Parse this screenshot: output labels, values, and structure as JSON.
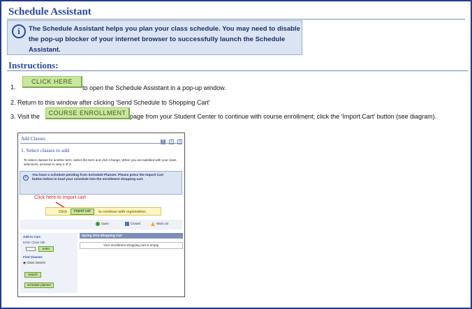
{
  "header": {
    "title": "Schedule Assistant",
    "info_icon": "info-icon",
    "info_text": "The Schedule Assistant helps you plan your class schedule.  You may need to disable the pop-up blocker of your internet browser to successfully launch the Schedule Assistant."
  },
  "instructions": {
    "title": "Instructions:",
    "step1": {
      "num": "1.",
      "button": "CLICK HERE",
      "after": "to open the Schedule Assistant in a pop-up window."
    },
    "step2": {
      "text": "2. Return to this window after clicking  'Send Schedule to Shopping Cart'"
    },
    "step3": {
      "before": "3. Visit the",
      "button": "COURSE ENROLLMENT",
      "after": "page from your Student Center to continue with course enrollment; click the 'Import Cart' button (see diagram)."
    }
  },
  "diagram": {
    "title": "Add Classes",
    "steps": [
      "1",
      "2",
      "3"
    ],
    "heading": "1.  Select classes to add",
    "description": "To select classes for another term, select the term and click Change.  When you are satisfied with your class selections, proceed to step 2 of 3.",
    "pending_text": "You have a schedule pending from Schedule Planner.  Please press the Import Cart button below to load your schedule into the enrollment shopping cart.",
    "callout": "Click here to import cart",
    "click_label": "Click",
    "import_button": "import cart",
    "continue_text": "to continue with registration.",
    "legend": [
      {
        "label": "Open",
        "color": "#3a9a3a"
      },
      {
        "label": "Closed",
        "color": "#4a74c9"
      },
      {
        "label": "Wait List",
        "color": "#e8b020"
      }
    ],
    "left_panel": {
      "add_to_cart": "Add to Cart:",
      "enter_class_nbr": "Enter Class Nbr",
      "enter_button": "enter",
      "find_classes": "Find Classes",
      "class_search": "Class Search",
      "search_button": "search",
      "planner_button": "schedule planner"
    },
    "cart": {
      "heading": "Spring 2014 Shopping Cart",
      "empty_message": "Your enrollment shopping cart is empty."
    }
  }
}
